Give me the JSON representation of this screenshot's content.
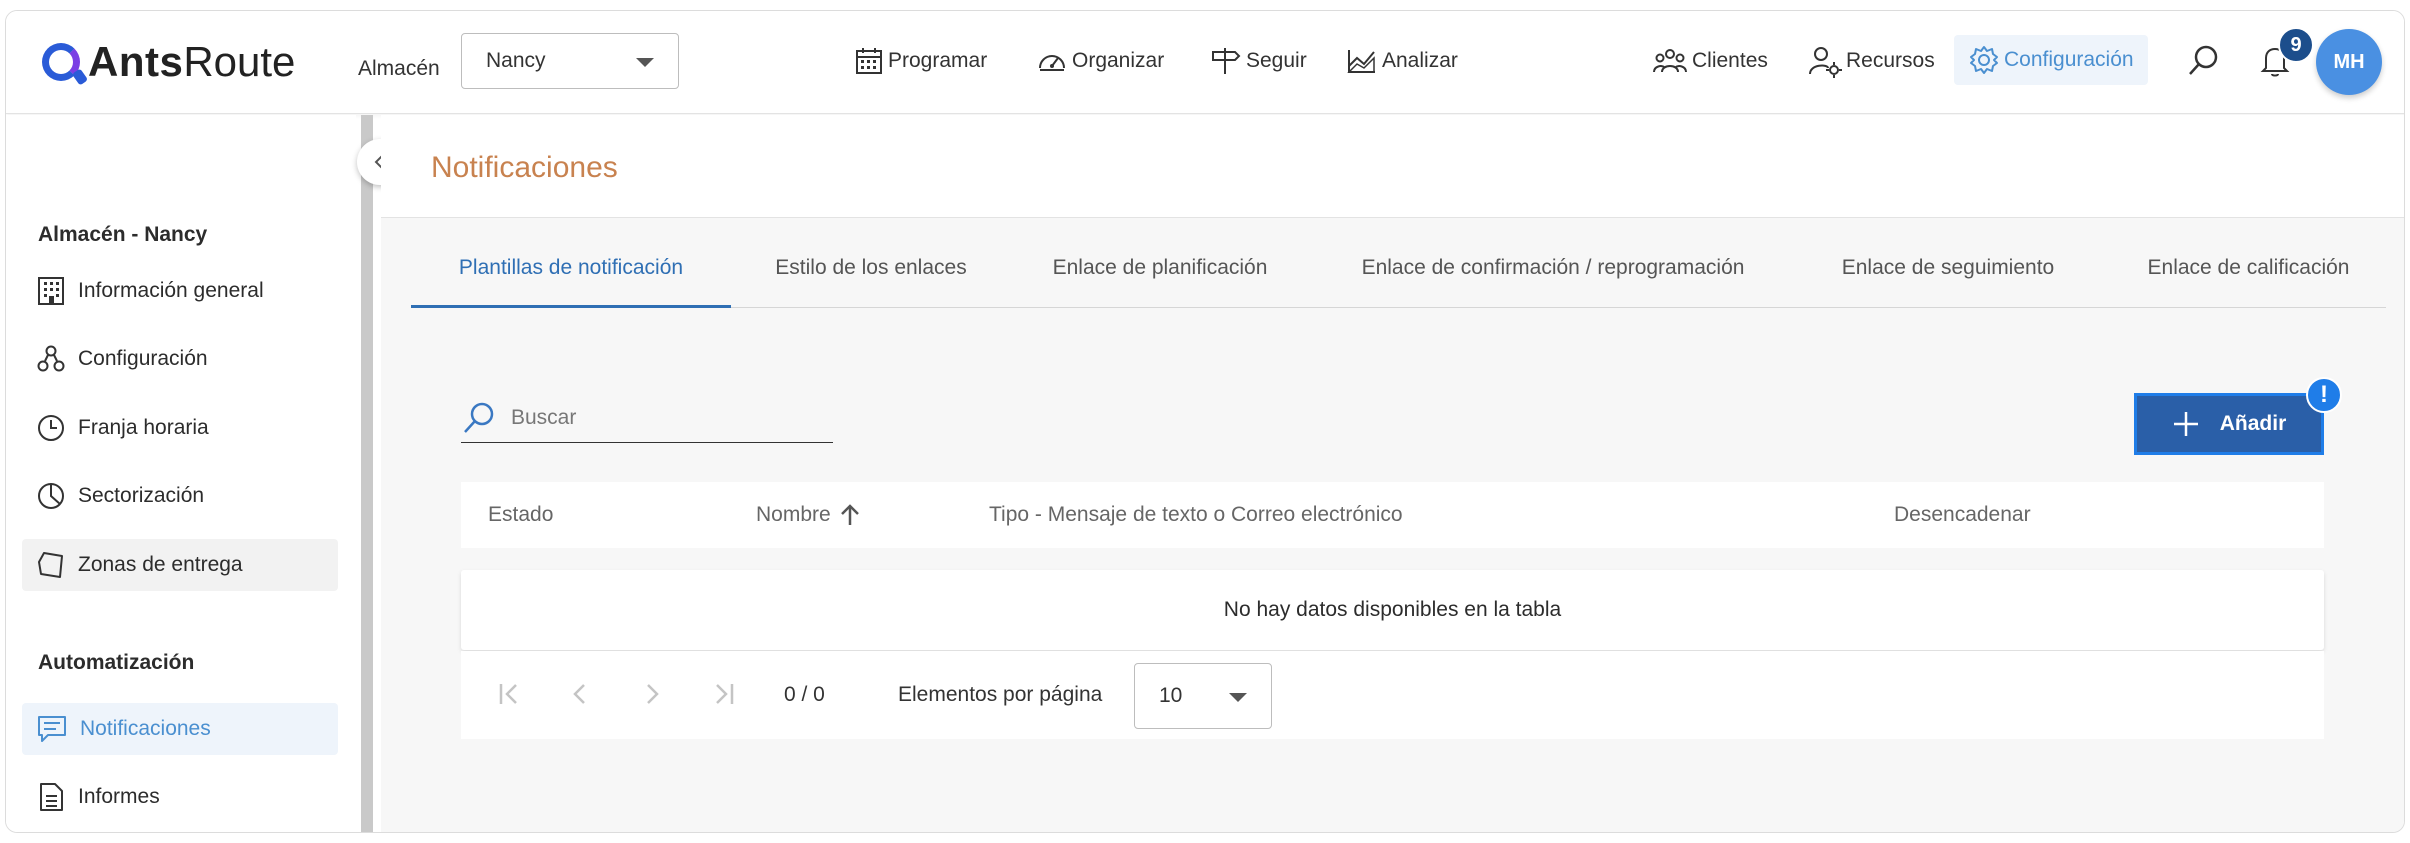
{
  "app": {
    "logo_bold": "Ants",
    "logo_light": "Route"
  },
  "header": {
    "warehouse_label": "Almacén",
    "warehouse_value": "Nancy",
    "nav": [
      {
        "label": "Programar",
        "icon": "calendar-icon"
      },
      {
        "label": "Organizar",
        "icon": "gauge-icon"
      },
      {
        "label": "Seguir",
        "icon": "signpost-icon"
      },
      {
        "label": "Analizar",
        "icon": "chart-icon"
      }
    ],
    "right_nav": [
      {
        "label": "Clientes",
        "icon": "users-icon"
      },
      {
        "label": "Recursos",
        "icon": "user-gear-icon"
      },
      {
        "label": "Configuración",
        "icon": "gear-icon",
        "active": true
      }
    ],
    "notification_count": "9",
    "avatar_initials": "MH"
  },
  "sidebar": {
    "section1_title": "Almacén - Nancy",
    "section1_items": [
      {
        "label": "Información general",
        "icon": "building-icon"
      },
      {
        "label": "Configuración",
        "icon": "nodes-icon"
      },
      {
        "label": "Franja horaria",
        "icon": "clock-icon"
      },
      {
        "label": "Sectorización",
        "icon": "pie-icon"
      },
      {
        "label": "Zonas de entrega",
        "icon": "polygon-icon"
      }
    ],
    "section2_title": "Automatización",
    "section2_items": [
      {
        "label": "Notificaciones",
        "icon": "message-icon",
        "active": true
      },
      {
        "label": "Informes",
        "icon": "document-icon"
      }
    ]
  },
  "page": {
    "title": "Notificaciones",
    "tabs": [
      {
        "label": "Plantillas de notificación",
        "active": true
      },
      {
        "label": "Estilo de los enlaces"
      },
      {
        "label": "Enlace de planificación"
      },
      {
        "label": "Enlace de confirmación / reprogramación"
      },
      {
        "label": "Enlace de seguimiento"
      },
      {
        "label": "Enlace de calificación"
      }
    ],
    "search_placeholder": "Buscar",
    "add_button": "Añadir",
    "add_badge": "!",
    "table": {
      "columns": [
        "Estado",
        "Nombre",
        "Tipo - Mensaje de texto o Correo electrónico",
        "Desencadenar"
      ],
      "sort_column": "Nombre",
      "sort_direction": "ascending",
      "empty_text": "No hay datos disponibles en la tabla"
    },
    "pagination": {
      "count": "0 / 0",
      "per_page_label": "Elementos por página",
      "per_page_value": "10"
    }
  },
  "colors": {
    "accent_blue": "#2a5fa8",
    "active_link": "#4a8fd0",
    "title_orange": "#c8824f",
    "badge_navy": "#1c4e8c"
  }
}
